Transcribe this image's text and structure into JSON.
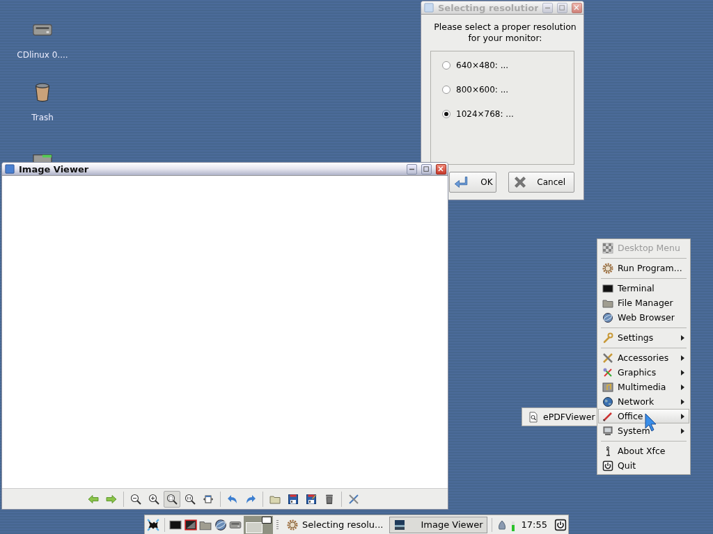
{
  "desktop_icons": [
    {
      "kind": "drive",
      "label": "CDlinux 0...."
    },
    {
      "kind": "trash",
      "label": "Trash"
    },
    {
      "kind": "window"
    }
  ],
  "windows": [
    {
      "kind": "dialog",
      "title": "Selecting resolutior",
      "active": false,
      "message": "Please select a proper resolution for your monitor:",
      "options": [
        {
          "label": "640×480: ...",
          "selected": false
        },
        {
          "label": "800×600: ...",
          "selected": false
        },
        {
          "label": "1024×768: ...",
          "selected": true
        }
      ],
      "buttons": [
        {
          "kind": "ok",
          "label": "OK"
        },
        {
          "kind": "cancel",
          "label": "Cancel"
        }
      ]
    },
    {
      "kind": "viewer",
      "title": "Image Viewer",
      "active": true,
      "toolbar": [
        [
          {
            "kind": "back",
            "selected": false
          },
          {
            "kind": "forward",
            "selected": false
          }
        ],
        [
          {
            "kind": "zoom_out",
            "selected": false
          },
          {
            "kind": "zoom_in",
            "selected": false
          },
          {
            "kind": "zoom_fit",
            "selected": true
          },
          {
            "kind": "zoom_100",
            "selected": false
          },
          {
            "kind": "fit_window",
            "selected": false
          }
        ],
        [
          {
            "kind": "rotate_left",
            "selected": false
          },
          {
            "kind": "rotate_right",
            "selected": false
          }
        ],
        [
          {
            "kind": "open",
            "selected": false
          },
          {
            "kind": "save",
            "selected": false
          },
          {
            "kind": "save_as",
            "selected": false
          },
          {
            "kind": "delete",
            "selected": false
          }
        ],
        [
          {
            "kind": "preferences",
            "selected": false
          }
        ]
      ]
    }
  ],
  "menu": {
    "sections": [
      [
        {
          "kind": "checker",
          "label": "Desktop Menu",
          "disabled": true,
          "selected": false,
          "submenu": false
        }
      ],
      [
        {
          "kind": "gear",
          "label": "Run Program...",
          "disabled": false,
          "selected": false,
          "submenu": false
        }
      ],
      [
        {
          "kind": "terminal",
          "label": "Terminal",
          "disabled": false,
          "selected": false,
          "submenu": false
        },
        {
          "kind": "files",
          "label": "File Manager",
          "disabled": false,
          "selected": false,
          "submenu": false
        },
        {
          "kind": "globe",
          "label": "Web Browser",
          "disabled": false,
          "selected": false,
          "submenu": false
        }
      ],
      [
        {
          "kind": "wrench",
          "label": "Settings",
          "disabled": false,
          "selected": false,
          "submenu": true
        }
      ],
      [
        {
          "kind": "tools",
          "label": "Accessories",
          "disabled": false,
          "selected": false,
          "submenu": true
        },
        {
          "kind": "graphics",
          "label": "Graphics",
          "disabled": false,
          "selected": false,
          "submenu": true
        },
        {
          "kind": "multimedia",
          "label": "Multimedia",
          "disabled": false,
          "selected": false,
          "submenu": true
        },
        {
          "kind": "network",
          "label": "Network",
          "disabled": false,
          "selected": false,
          "submenu": true
        },
        {
          "kind": "pencil",
          "label": "Office",
          "disabled": false,
          "selected": true,
          "submenu": true
        },
        {
          "kind": "computer",
          "label": "System",
          "disabled": false,
          "selected": false,
          "submenu": true
        }
      ],
      [
        {
          "kind": "info",
          "label": "About Xfce",
          "disabled": false,
          "selected": false,
          "submenu": false
        },
        {
          "kind": "power",
          "label": "Quit",
          "disabled": false,
          "selected": false,
          "submenu": false
        }
      ]
    ]
  },
  "submenu": {
    "items": [
      {
        "kind": "document",
        "label": "ePDFViewer",
        "selected": false
      }
    ]
  },
  "taskbar": {
    "launchers": [
      {
        "kind": "xfce"
      },
      {
        "kind": "terminal"
      },
      {
        "kind": "display"
      },
      {
        "kind": "files"
      },
      {
        "kind": "globe"
      },
      {
        "kind": "drive"
      }
    ],
    "tasks": [
      {
        "kind": "gear",
        "label": "Selecting resolu...",
        "selected": false
      },
      {
        "kind": "thumbnail",
        "label": "Image Viewer",
        "selected": true
      }
    ],
    "cpu_meter": {
      "level": 0.6
    },
    "clock": "17:55"
  }
}
